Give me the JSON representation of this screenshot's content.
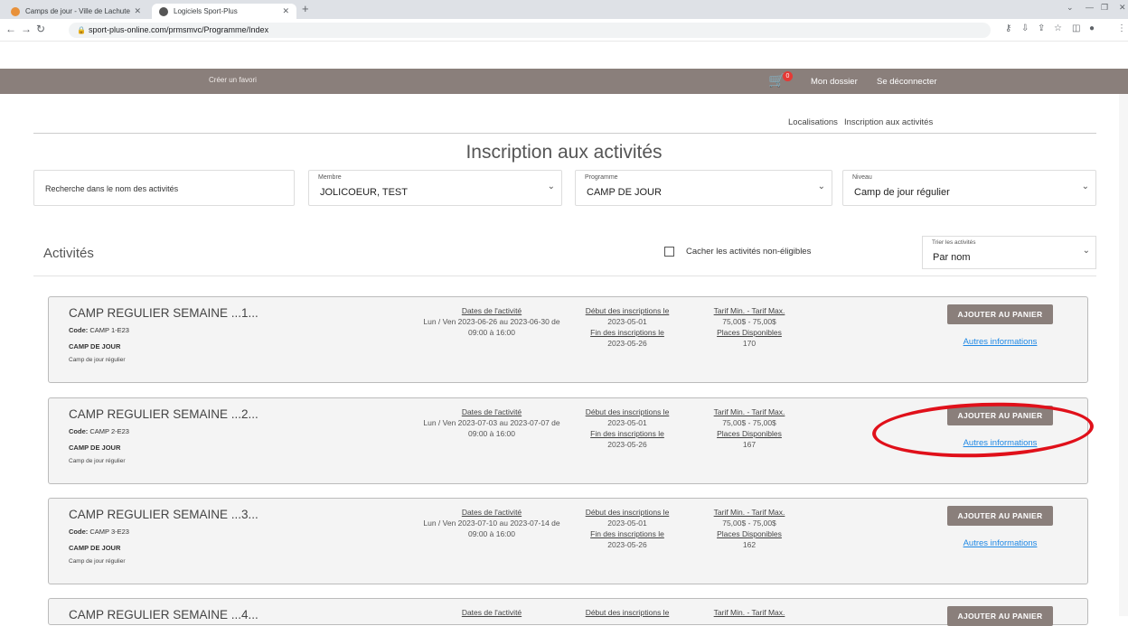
{
  "browser": {
    "tabs": [
      {
        "title": "Camps de jour - Ville de Lachute",
        "color": "#e8913a"
      },
      {
        "title": "Logiciels Sport-Plus",
        "color": "#555555"
      }
    ],
    "new_tab": "+",
    "url": "sport-plus-online.com/prmsmvc/Programme/Index"
  },
  "topnav": {
    "favori": "Créer un favori",
    "cart_count": "0",
    "mon_dossier": "Mon dossier",
    "logout": "Se déconnecter"
  },
  "secnav": {
    "localisations": "Localisations",
    "inscription": "Inscription aux activités"
  },
  "page_title": "Inscription aux activités",
  "filters": {
    "search_placeholder": "Recherche dans le nom des activités",
    "membre_label": "Membre",
    "membre_value": "JOLICOEUR, TEST",
    "programme_label": "Programme",
    "programme_value": "CAMP DE JOUR",
    "niveau_label": "Niveau",
    "niveau_value": "Camp de jour régulier"
  },
  "activities_heading": "Activités",
  "hide_ineligible": "Cacher les activités non-éligibles",
  "sort": {
    "label": "Trier les activités",
    "value": "Par nom"
  },
  "cards": [
    {
      "name": "CAMP REGULIER SEMAINE ...1...",
      "code_label": "Code:",
      "code": "CAMP 1-E23",
      "programme": "CAMP DE JOUR",
      "niveau": "Camp de jour régulier",
      "dates_label": "Dates de l'activité",
      "dates": "Lun / Ven 2023-06-26 au 2023-06-30 de",
      "hours": "09:00 à 16:00",
      "debut_label": "Début des inscriptions le",
      "debut": "2023-05-01",
      "fin_label": "Fin des inscriptions le",
      "fin": "2023-05-26",
      "tarif_label": "Tarif Min. - Tarif Max.",
      "tarif": "75,00$ - 75,00$",
      "places_label": "Places Disponibles",
      "places": "170",
      "add_label": "AJOUTER AU PANIER",
      "more_label": "Autres informations"
    },
    {
      "name": "CAMP REGULIER SEMAINE ...2...",
      "code_label": "Code:",
      "code": "CAMP 2-E23",
      "programme": "CAMP DE JOUR",
      "niveau": "Camp de jour régulier",
      "dates_label": "Dates de l'activité",
      "dates": "Lun / Ven 2023-07-03 au 2023-07-07 de",
      "hours": "09:00 à 16:00",
      "debut_label": "Début des inscriptions le",
      "debut": "2023-05-01",
      "fin_label": "Fin des inscriptions le",
      "fin": "2023-05-26",
      "tarif_label": "Tarif Min. - Tarif Max.",
      "tarif": "75,00$ - 75,00$",
      "places_label": "Places Disponibles",
      "places": "167",
      "add_label": "AJOUTER AU PANIER",
      "more_label": "Autres informations"
    },
    {
      "name": "CAMP REGULIER SEMAINE ...3...",
      "code_label": "Code:",
      "code": "CAMP 3-E23",
      "programme": "CAMP DE JOUR",
      "niveau": "Camp de jour régulier",
      "dates_label": "Dates de l'activité",
      "dates": "Lun / Ven 2023-07-10 au 2023-07-14 de",
      "hours": "09:00 à 16:00",
      "debut_label": "Début des inscriptions le",
      "debut": "2023-05-01",
      "fin_label": "Fin des inscriptions le",
      "fin": "2023-05-26",
      "tarif_label": "Tarif Min. - Tarif Max.",
      "tarif": "75,00$ - 75,00$",
      "places_label": "Places Disponibles",
      "places": "162",
      "add_label": "AJOUTER AU PANIER",
      "more_label": "Autres informations"
    },
    {
      "name": "CAMP REGULIER SEMAINE ...4...",
      "dates_label": "Dates de l'activité",
      "debut_label": "Début des inscriptions le",
      "tarif_label": "Tarif Min. - Tarif Max.",
      "add_label": "AJOUTER AU PANIER"
    }
  ]
}
